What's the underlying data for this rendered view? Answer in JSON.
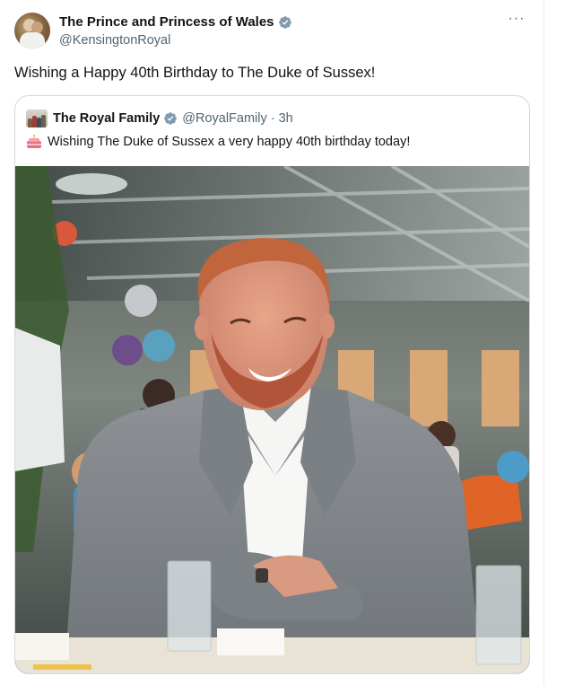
{
  "author": {
    "display_name": "The Prince and Princess of Wales",
    "handle": "@KensingtonRoyal",
    "avatar_icon": "profile-photo",
    "verified_icon": "verified-badge-icon"
  },
  "tweet": {
    "text": "Wishing a Happy 40th Birthday to The Duke of Sussex!"
  },
  "more_icon": "more-options-icon",
  "quoted_tweet": {
    "display_name": "The Royal Family",
    "handle": "@RoyalFamily",
    "separator": "·",
    "time": "3h",
    "emoji_icon": "birthday-cake-icon",
    "text": "Wishing The Duke of Sussex a very happy 40th birthday today!",
    "image": "photo-of-smiling-man-in-grey-suit-at-table"
  },
  "colors": {
    "text": "#0f1419",
    "secondary_text": "#536471",
    "verified": "#829aab",
    "border": "#cfd9de"
  }
}
